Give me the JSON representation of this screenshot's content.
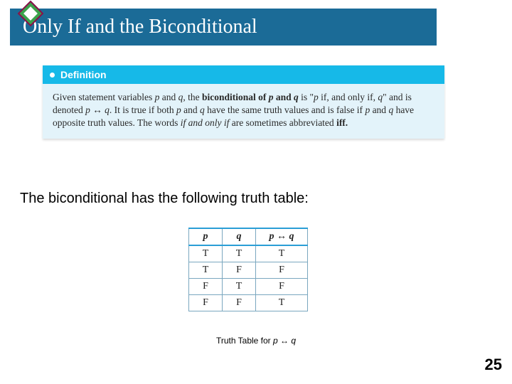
{
  "title": "Only If and the Biconditional",
  "definition": {
    "header": "Definition",
    "l1a": "Given statement variables ",
    "p": "p",
    "l1b": " and ",
    "q": "q",
    "l1c": ", the ",
    "bold1": "biconditional of ",
    "boldp": "p",
    "bold2": " and ",
    "boldq": "q",
    "l1d": " is \"",
    "pif": "p",
    "l1e": " if, and only if, ",
    "qq": "q",
    "l1f": "\" and is denoted ",
    "sym": "p ↔ q",
    "l1g": ". It is true if both ",
    "p2": "p",
    "l1h": " and ",
    "q2": "q",
    "l1i": " have the same truth values and is false if ",
    "p3": "p",
    "l1j": " and ",
    "q3": "q",
    "l1k": " have opposite truth values. The words ",
    "iff1": "if and only if",
    "l1l": " are sometimes abbreviated ",
    "iff2": "iff."
  },
  "lead": "The biconditional has the following truth table:",
  "table": {
    "h1": "p",
    "h2": "q",
    "h3": "p ↔ q",
    "rows": [
      {
        "p": "T",
        "q": "T",
        "r": "T"
      },
      {
        "p": "T",
        "q": "F",
        "r": "F"
      },
      {
        "p": "F",
        "q": "T",
        "r": "F"
      },
      {
        "p": "F",
        "q": "F",
        "r": "T"
      }
    ]
  },
  "caption": {
    "a": "Truth Table for ",
    "b": "p ↔ q"
  },
  "page": "25",
  "chart_data": {
    "type": "table",
    "title": "Truth Table for p ↔ q",
    "columns": [
      "p",
      "q",
      "p ↔ q"
    ],
    "rows": [
      [
        "T",
        "T",
        "T"
      ],
      [
        "T",
        "F",
        "F"
      ],
      [
        "F",
        "T",
        "F"
      ],
      [
        "F",
        "F",
        "T"
      ]
    ]
  }
}
